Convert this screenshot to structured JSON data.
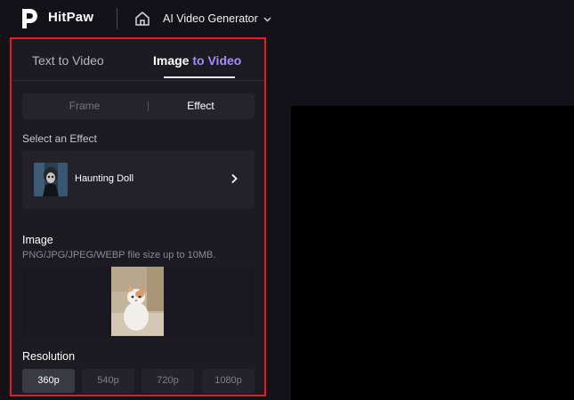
{
  "header": {
    "brand": "HitPaw",
    "app_name": "AI Video Generator",
    "icons": [
      "hitpaw-logo-icon",
      "home-icon",
      "chevron-down-icon"
    ]
  },
  "tabs": [
    {
      "label_a": "Text to Video"
    },
    {
      "label_a": "Image ",
      "label_b": "to Video",
      "active": true
    }
  ],
  "mode": {
    "options": [
      "Frame",
      "Effect"
    ],
    "selected": "Effect"
  },
  "effect": {
    "section_label": "Select an Effect",
    "name": "Haunting Doll",
    "icon": "chevron-right-icon"
  },
  "image": {
    "title": "Image",
    "hint": "PNG/JPG/JPEG/WEBP file size up to 10MB."
  },
  "resolution": {
    "title": "Resolution",
    "options": [
      "360p",
      "540p",
      "720p",
      "1080p"
    ],
    "selected": "360p"
  },
  "colors": {
    "background": "#131218",
    "panel": "#1c1b22",
    "highlight_border": "#e21c24",
    "accent": "#a58cff",
    "preview": "#000000"
  }
}
